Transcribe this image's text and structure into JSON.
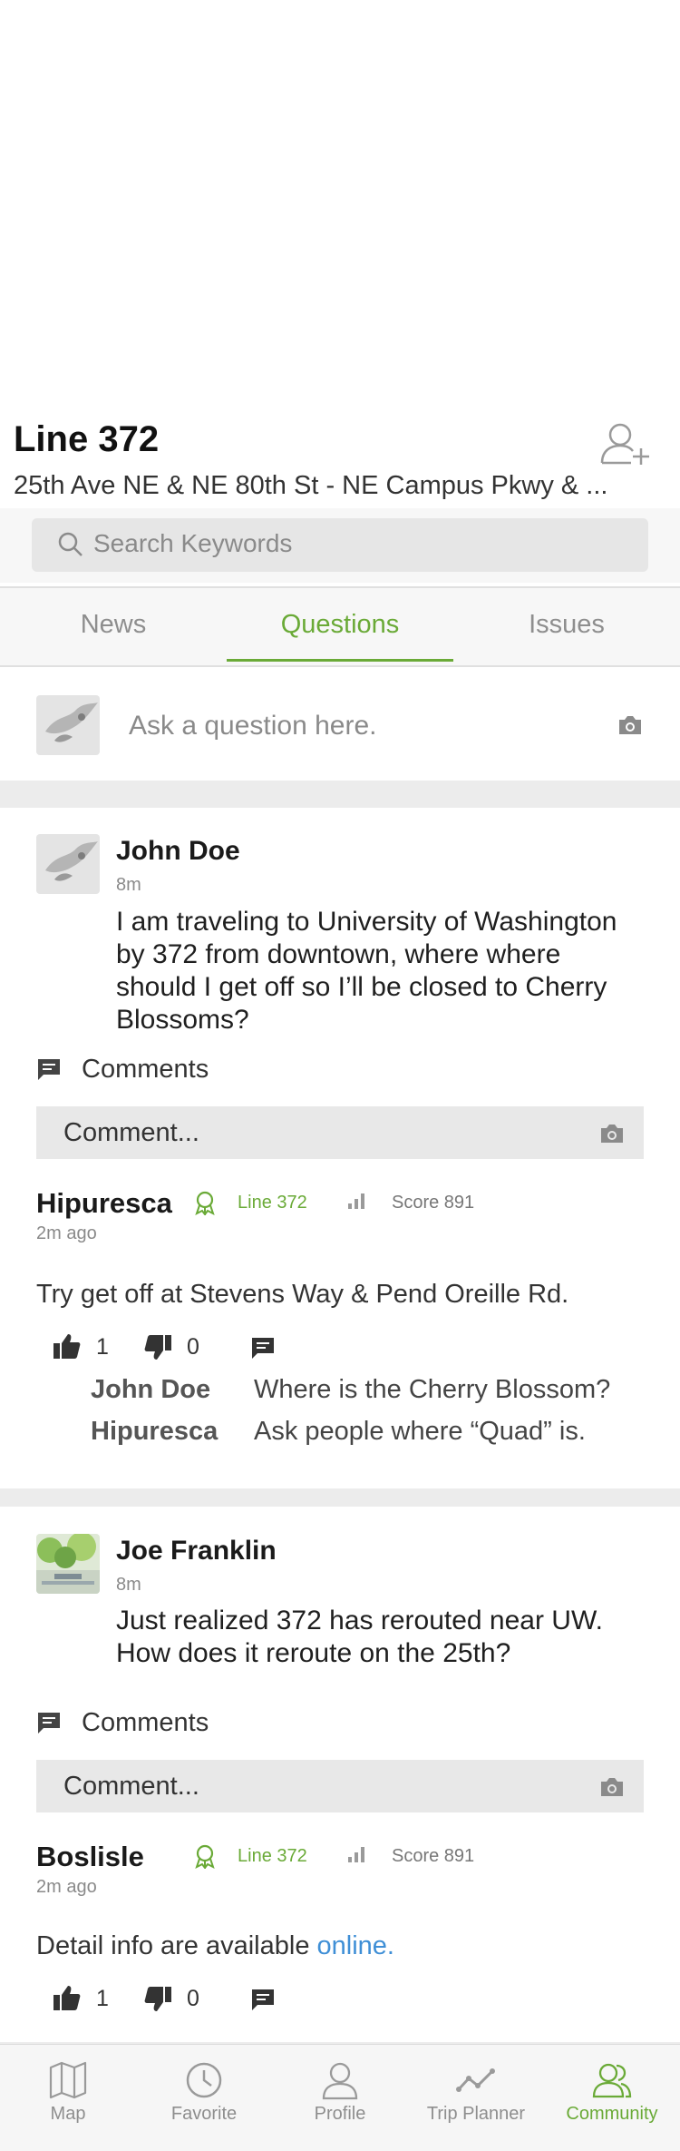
{
  "header": {
    "line_title": "Line 372",
    "route_subtitle": "25th Ave NE & NE 80th St - NE Campus Pkwy & ..."
  },
  "search": {
    "placeholder": "Search Keywords"
  },
  "tabs": [
    {
      "label": "News",
      "active": false
    },
    {
      "label": "Questions",
      "active": true
    },
    {
      "label": "Issues",
      "active": false
    }
  ],
  "composer": {
    "placeholder": "Ask a question here."
  },
  "posts": [
    {
      "author": "John Doe",
      "time": "8m",
      "text": "I am traveling to University of Washington by 372 from downtown, where where should I get off so I’ll be closed to Cherry Blossoms?",
      "comments_label": "Comments",
      "comment_placeholder": "Comment...",
      "reply": {
        "author": "Hipuresca",
        "line_badge": "Line 372",
        "score": "Score 891",
        "time": "2m ago",
        "text": "Try get off at Stevens Way & Pend Oreille Rd.",
        "likes": "1",
        "dislikes": "0",
        "thread": [
          {
            "name": "John Doe",
            "text": "Where is the Cherry Blossom?"
          },
          {
            "name": "Hipuresca",
            "text": "Ask people where “Quad” is."
          }
        ]
      }
    },
    {
      "author": "Joe Franklin",
      "time": "8m",
      "text": "Just realized 372 has rerouted near UW. How does it reroute on the 25th?",
      "comments_label": "Comments",
      "comment_placeholder": "Comment...",
      "reply": {
        "author": "Boslisle",
        "line_badge": "Line 372",
        "score": "Score 891",
        "time": "2m ago",
        "text_before_link": "Detail info are available ",
        "link_text": "online.",
        "likes": "1",
        "dislikes": "0"
      }
    }
  ],
  "bottom_nav": [
    {
      "label": "Map",
      "icon": "map-icon",
      "active": false
    },
    {
      "label": "Favorite",
      "icon": "clock-icon",
      "active": false
    },
    {
      "label": "Profile",
      "icon": "person-icon",
      "active": false
    },
    {
      "label": "Trip Planner",
      "icon": "trip-line-icon",
      "active": false
    },
    {
      "label": "Community",
      "icon": "community-icon",
      "active": true
    }
  ],
  "colors": {
    "accent": "#6aaa37",
    "link": "#3f8fd6",
    "separator": "#ececec"
  }
}
